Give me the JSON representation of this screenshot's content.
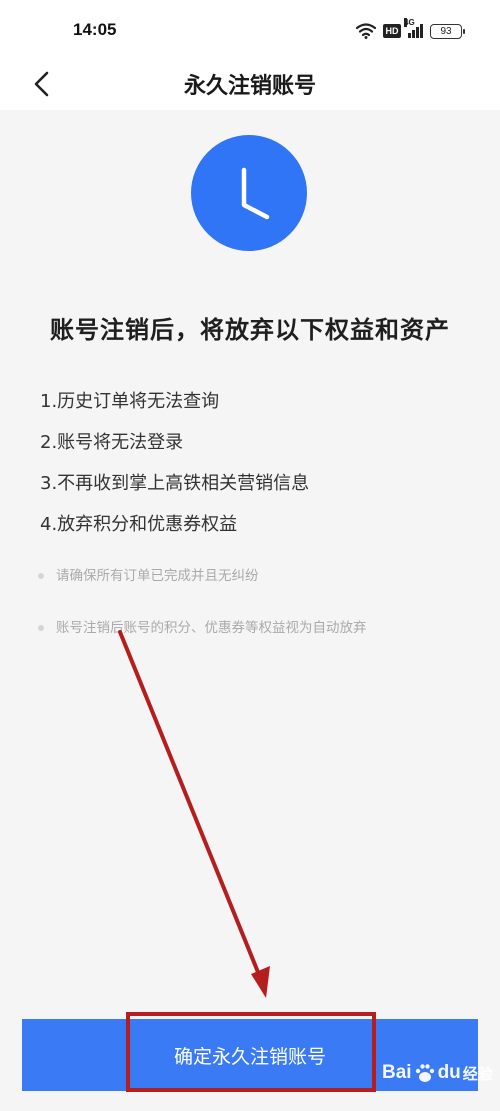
{
  "status_bar": {
    "time": "14:05",
    "hd_label": "HD",
    "signal_label": "4G",
    "battery": "93",
    "icons": [
      "wifi-icon",
      "hd-icon",
      "signal-icon",
      "battery-icon"
    ]
  },
  "nav": {
    "back_icon": "chevron-left-icon",
    "title": "永久注销账号"
  },
  "hero": {
    "icon": "clock-icon",
    "accent_color": "#2f75f5"
  },
  "headline": "账号注销后，将放弃以下权益和资产",
  "rights": [
    "1.历史订单将无法查询",
    "2.账号将无法登录",
    "3.不再收到掌上高铁相关营销信息",
    "4.放弃积分和优惠券权益"
  ],
  "notes": [
    "请确保所有订单已完成并且无纠纷",
    "账号注销后账号的积分、优惠券等权益视为自动放弃"
  ],
  "confirm_button": {
    "label": "确定永久注销账号",
    "color": "#3a7af5"
  },
  "annotation": {
    "color": "#b41e1e"
  },
  "watermark": {
    "brand_left": "Bai",
    "brand_right": "du",
    "suffix": "经验"
  }
}
